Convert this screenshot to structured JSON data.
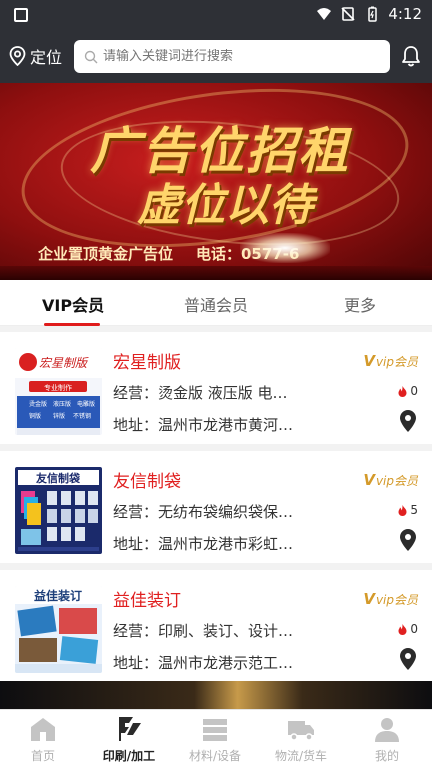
{
  "status_bar": {
    "time": "4:12"
  },
  "header": {
    "location_label": "定位",
    "search_placeholder": "请输入关键词进行搜索"
  },
  "banner": {
    "headline_1": "广告位招租",
    "headline_2": "虚位以待",
    "subline_left": "企业置顶黄金广告位",
    "subline_right": "电话：0577-6"
  },
  "tabs": [
    {
      "label": "VIP会员",
      "active": true
    },
    {
      "label": "普通会员",
      "active": false
    },
    {
      "label": "更多",
      "active": false
    }
  ],
  "listings": [
    {
      "name": "宏星制版",
      "vip_label": "vip会员",
      "business": "经营：烫金版 液压版 电…",
      "address": "地址：温州市龙港市黄河…",
      "hot_count": "0",
      "thumb": {
        "title": "宏星制版",
        "tag": "专业制作",
        "items": [
          "烫金版",
          "液压版",
          "电雕版",
          "铜版",
          "锌版",
          "不锈钢"
        ]
      }
    },
    {
      "name": "友信制袋",
      "vip_label": "vip会员",
      "business": "经营：无纺布袋编织袋保…",
      "address": "地址：温州市龙港市彩虹…",
      "hot_count": "5",
      "thumb": {
        "title": "友信制袋",
        "tag": "",
        "items": []
      }
    },
    {
      "name": "益佳装订",
      "vip_label": "vip会员",
      "business": "经营：印刷、装订、设计…",
      "address": "地址：温州市龙港示范工…",
      "hot_count": "0",
      "thumb": {
        "title": "益佳装订",
        "tag": "",
        "items": []
      }
    }
  ],
  "bottom_nav": [
    {
      "label": "首页",
      "icon": "home-icon",
      "active": false
    },
    {
      "label": "印刷/加工",
      "icon": "print-icon",
      "active": true
    },
    {
      "label": "材料/设备",
      "icon": "materials-icon",
      "active": false
    },
    {
      "label": "物流/货车",
      "icon": "truck-icon",
      "active": false
    },
    {
      "label": "我的",
      "icon": "user-icon",
      "active": false
    }
  ],
  "colors": {
    "accent": "#e02020",
    "vip_gold": "#d49a2a",
    "header_bg": "#2e3036"
  }
}
